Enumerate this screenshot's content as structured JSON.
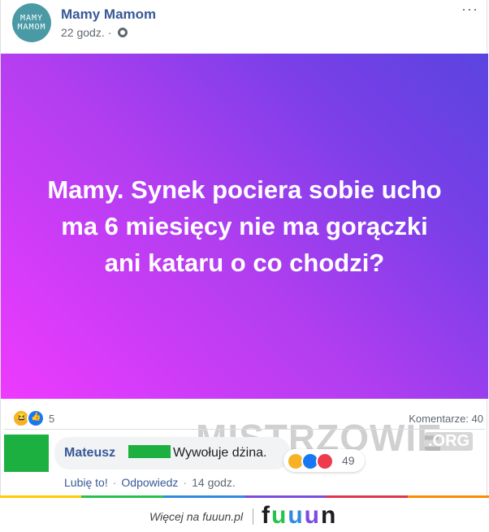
{
  "post": {
    "page_name": "Mamy Mamom",
    "avatar_text": [
      "MAMY",
      "MAMOM"
    ],
    "time": "22 godz.",
    "time_separator": "·",
    "more": "···",
    "hero_text": "Mamy. Synek pociera sobie ucho ma 6 miesięcy nie ma gorączki ani kataru o co chodzi?",
    "reactions_count": "5",
    "comments_label": "Komentarze: 40"
  },
  "comment": {
    "author": "Mateusz",
    "text": "Wywołuje dżina.",
    "reactions_count": "49",
    "like": "Lubię to!",
    "reply": "Odpowiedz",
    "separator": "·",
    "time": "14 godz."
  },
  "watermark": {
    "text": "MISTRZOWIE",
    "org": ".ORG"
  },
  "footer": {
    "text": "Więcej na fuuun.pl",
    "logo": [
      "f",
      "u",
      "u",
      "u",
      "n"
    ],
    "bar_colors": [
      "#ffcc00",
      "#27c24c",
      "#2f8ae0",
      "#7b4ce0",
      "#e0344c",
      "#ff8a00"
    ]
  },
  "colors": {
    "link": "#385898",
    "hero_gradient_start": "#ee3aff",
    "hero_gradient_end": "#5a44e0",
    "redact_green": "#1cb040"
  }
}
